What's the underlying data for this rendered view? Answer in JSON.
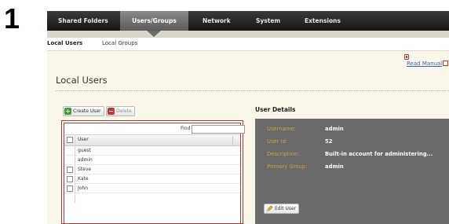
{
  "step_number": "1",
  "topnav": {
    "tabs": [
      {
        "label": "Shared Folders",
        "active": false
      },
      {
        "label": "Users/Groups",
        "active": true
      },
      {
        "label": "Network",
        "active": false
      },
      {
        "label": "System",
        "active": false
      },
      {
        "label": "Extensions",
        "active": false
      }
    ]
  },
  "subnav": {
    "tabs": [
      {
        "label": "Local Users",
        "active": true
      },
      {
        "label": "Local Groups",
        "active": false
      }
    ]
  },
  "help": {
    "read_manual": "Read Manual"
  },
  "page": {
    "title": "Local Users"
  },
  "toolbar": {
    "create_label": "Create User",
    "delete_label": "Delete"
  },
  "user_list": {
    "find_label": "Find",
    "find_value": "",
    "column_header": "User",
    "rows": [
      {
        "name": "guest",
        "has_checkbox": false
      },
      {
        "name": "admin",
        "has_checkbox": false
      },
      {
        "name": "Steve",
        "has_checkbox": true
      },
      {
        "name": "Kate",
        "has_checkbox": true
      },
      {
        "name": "John",
        "has_checkbox": true
      }
    ]
  },
  "user_details": {
    "heading": "User Details",
    "fields": [
      {
        "label": "Username:",
        "value": "admin"
      },
      {
        "label": "User Id:",
        "value": "52"
      },
      {
        "label": "Description:",
        "value": "Built-in account for administering..."
      },
      {
        "label": "Primary Group:",
        "value": "admin"
      }
    ],
    "edit_label": "Edit User"
  },
  "colors": {
    "accent_label": "#c9a24a",
    "details_bg": "#6a6a6a",
    "nav_bg": "#1f1f1f",
    "panel_border": "#a63d3d",
    "link": "#3b64b3"
  },
  "icons": {
    "create": "plus-icon",
    "delete": "minus-icon",
    "edit": "pencil-icon",
    "manual": "document-icon",
    "external": "external-link-icon"
  }
}
